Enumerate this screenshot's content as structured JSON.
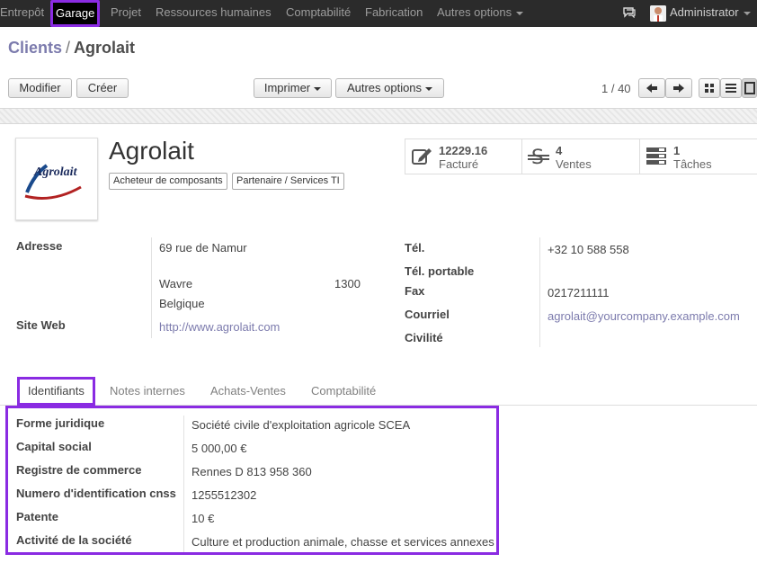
{
  "navbar": {
    "menu": [
      "Entrepôt",
      "Garage",
      "Projet",
      "Ressources humaines",
      "Comptabilité",
      "Fabrication",
      "Autres options"
    ],
    "user": "Administrator"
  },
  "breadcrumb": {
    "parent": "Clients",
    "separator": "/",
    "current": "Agrolait"
  },
  "buttons": {
    "edit": "Modifier",
    "create": "Créer",
    "print": "Imprimer",
    "more": "Autres options"
  },
  "pager": {
    "value": "1 / 40"
  },
  "partner": {
    "name": "Agrolait",
    "logo_text": "Agrolait",
    "tags": [
      "Acheteur de composants",
      "Partenaire / Services TI"
    ]
  },
  "stats": [
    {
      "value": "12229.16",
      "label": "Facturé",
      "icon": "invoice-edit-icon"
    },
    {
      "value": "4",
      "label": "Ventes",
      "icon": "dollar-icon"
    },
    {
      "value": "1",
      "label": "Tâches",
      "icon": "tasks-icon"
    }
  ],
  "address": {
    "label": "Adresse",
    "street": "69 rue de Namur",
    "city": "Wavre",
    "zip": "1300",
    "country": "Belgique",
    "website_label": "Site Web",
    "website": "http://www.agrolait.com"
  },
  "contact": {
    "phone_label": "Tél.",
    "phone": "+32 10 588 558",
    "mobile_label": "Tél. portable",
    "mobile": "",
    "fax_label": "Fax",
    "fax": "0217211111",
    "email_label": "Courriel",
    "email": "agrolait@yourcompany.example.com",
    "title_label": "Civilité",
    "title": ""
  },
  "tabs": [
    "Identifiants",
    "Notes internes",
    "Achats-Ventes",
    "Comptabilité"
  ],
  "identifiers": [
    {
      "label": "Forme juridique",
      "value": "Société civile d'exploitation agricole SCEA"
    },
    {
      "label": "Capital social",
      "value": "5 000,00 €"
    },
    {
      "label": "Registre de commerce",
      "value": "Rennes D 813 958 360"
    },
    {
      "label": "Numero d'identification cnss",
      "value": "1255512302"
    },
    {
      "label": "Patente",
      "value": "10 €"
    },
    {
      "label": "Activité de la société",
      "value": "Culture et production animale, chasse et services annexes"
    }
  ],
  "colors": {
    "accent": "#7c7bad",
    "highlight": "#8a2be2",
    "navbar": "#2b2b2b"
  }
}
